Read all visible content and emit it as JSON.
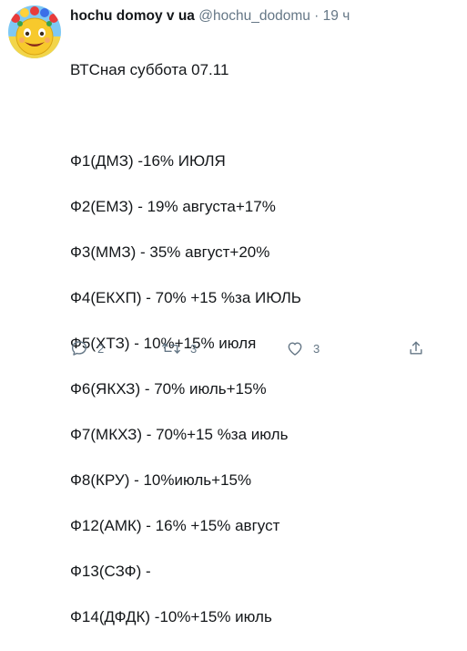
{
  "tweet": {
    "name": "hochu domoy v ua",
    "handle": "@hochu_dodomu",
    "separator": "·",
    "time": "19 ч",
    "lines": [
      "ВТСная суббота 07.11",
      "",
      "Ф1(ДМЗ) -16% ИЮЛЯ",
      "Ф2(ЕМЗ) - 19% августа+17%",
      "Ф3(ММЗ) - 35% август+20%",
      "Ф4(ЕКХП) - 70% +15 %за ИЮЛЬ",
      "Ф5(ХТЗ) - 10%+15% июля",
      "Ф6(ЯКХЗ) - 70% июль+15%",
      "Ф7(МКХЗ) - 70%+15 %за июль",
      "Ф8(КРУ) - 10%июль+15%",
      "Ф12(АМК) - 16% +15% август",
      "Ф13(СЗФ) -",
      "Ф14(ДФДК) -10%+15% июль"
    ]
  },
  "actions": {
    "reply_icon": "reply-icon",
    "reply_count": "2",
    "retweet_icon": "retweet-icon",
    "retweet_count": "3",
    "like_icon": "heart-icon",
    "like_count": "3",
    "share_icon": "share-icon"
  },
  "colors": {
    "text": "#14171a",
    "muted": "#657786",
    "avatar_sky": "#7ec8f4",
    "avatar_face": "#f7c92c"
  }
}
